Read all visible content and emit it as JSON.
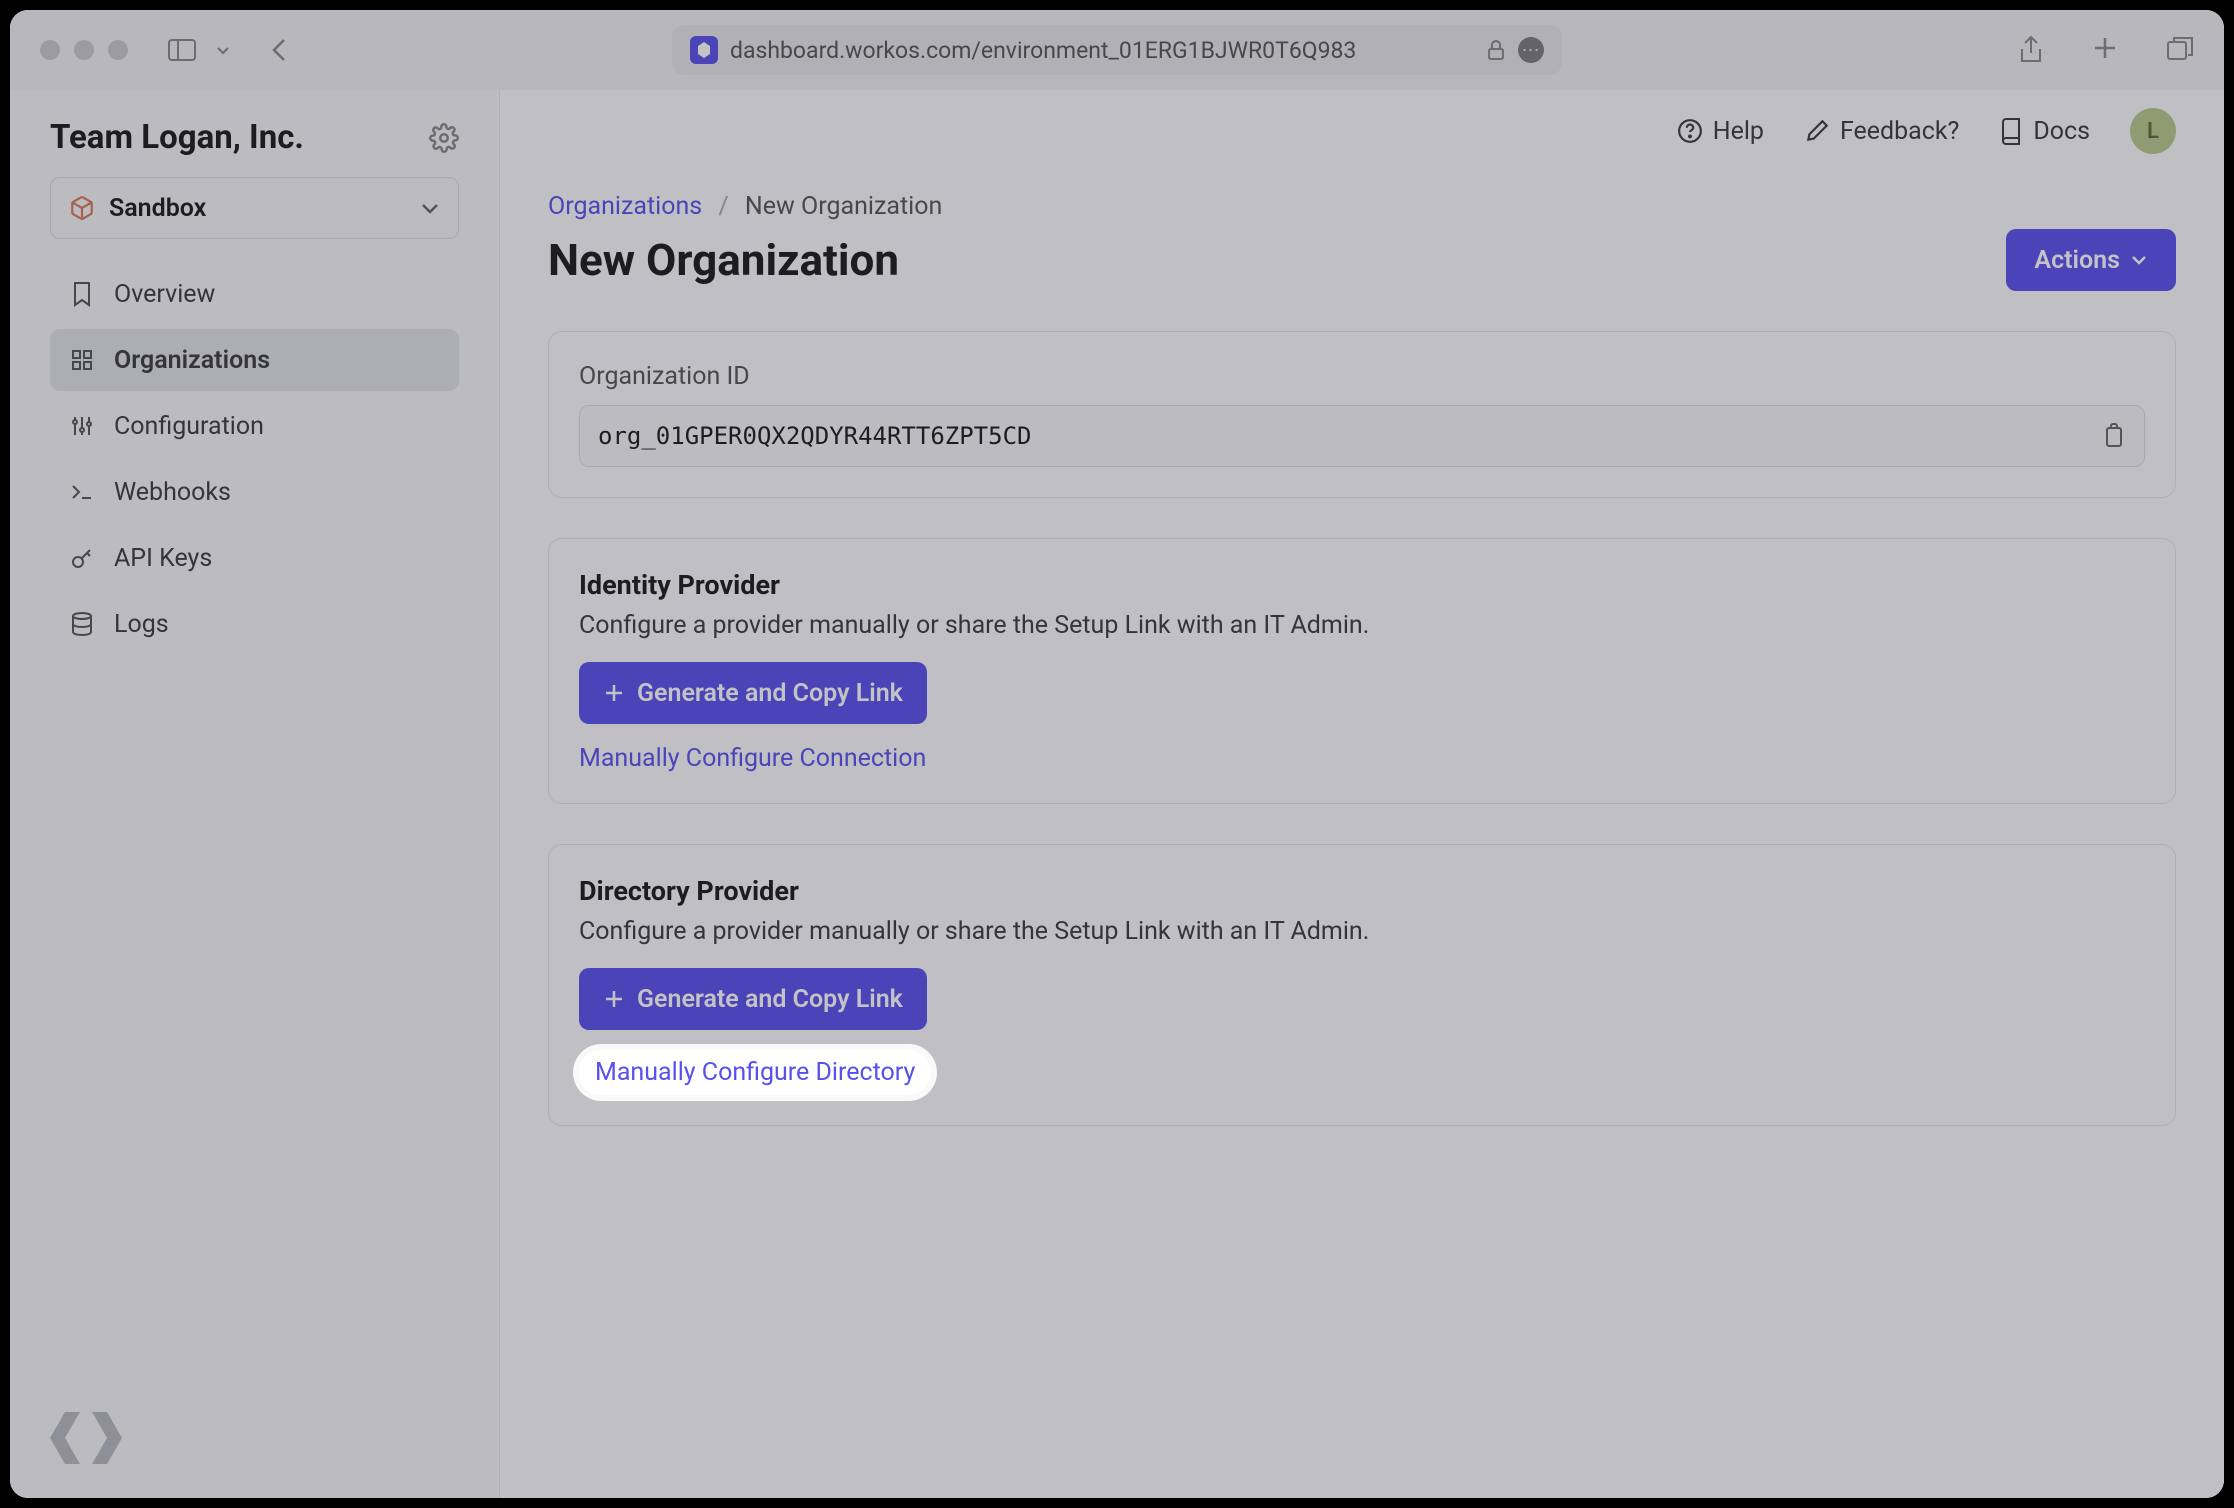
{
  "browser": {
    "url": "dashboard.workos.com/environment_01ERG1BJWR0T6Q983"
  },
  "sidebar": {
    "team_name": "Team Logan, Inc.",
    "environment": "Sandbox",
    "items": [
      {
        "label": "Overview",
        "icon": "bookmark"
      },
      {
        "label": "Organizations",
        "icon": "grid",
        "active": true
      },
      {
        "label": "Configuration",
        "icon": "sliders"
      },
      {
        "label": "Webhooks",
        "icon": "terminal"
      },
      {
        "label": "API Keys",
        "icon": "key"
      },
      {
        "label": "Logs",
        "icon": "database"
      }
    ]
  },
  "topnav": {
    "help": "Help",
    "feedback": "Feedback?",
    "docs": "Docs",
    "avatar_initial": "L"
  },
  "breadcrumb": {
    "root": "Organizations",
    "current": "New Organization"
  },
  "page": {
    "title": "New Organization",
    "actions_label": "Actions"
  },
  "org_id": {
    "label": "Organization ID",
    "value": "org_01GPER0QX2QDYR44RTT6ZPT5CD"
  },
  "identity": {
    "title": "Identity Provider",
    "desc": "Configure a provider manually or share the Setup Link with an IT Admin.",
    "button": "Generate and Copy Link",
    "link": "Manually Configure Connection"
  },
  "directory": {
    "title": "Directory Provider",
    "desc": "Configure a provider manually or share the Setup Link with an IT Admin.",
    "button": "Generate and Copy Link",
    "link": "Manually Configure Directory"
  }
}
